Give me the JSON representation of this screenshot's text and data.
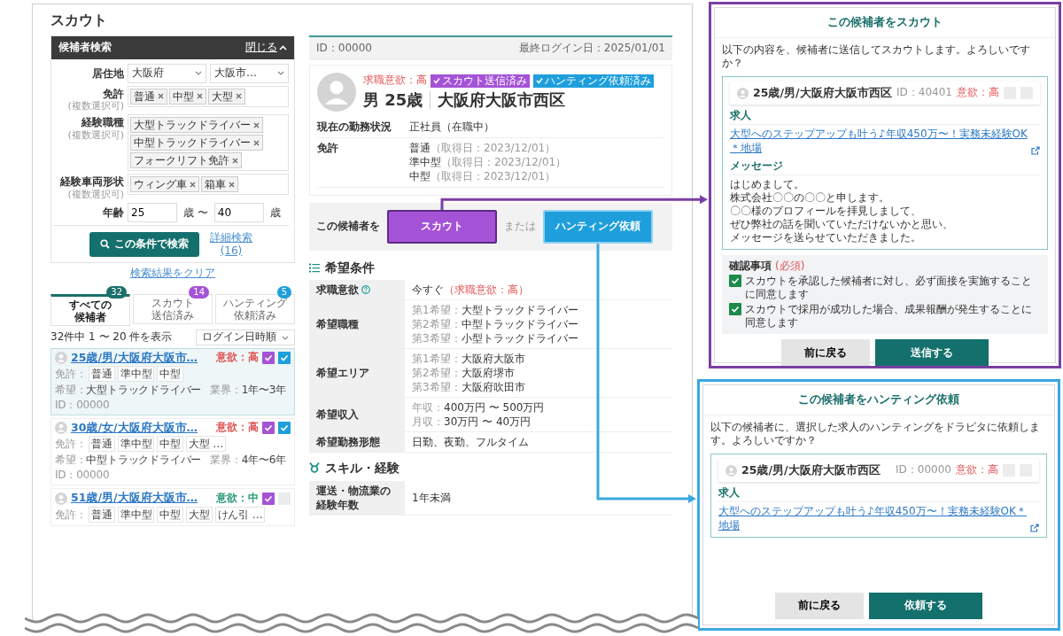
{
  "page": {
    "title": "スカウト"
  },
  "search_panel": {
    "title": "候補者検索",
    "toggle": "閉じる",
    "expanded": true,
    "fields": [
      {
        "kind": "selects",
        "label": "居住地",
        "values": [
          "大阪府",
          "大阪市…"
        ]
      },
      {
        "kind": "tags",
        "label": "免許",
        "note": "(複数選択可)",
        "tags": [
          "普通",
          "中型",
          "大型"
        ]
      },
      {
        "kind": "tags",
        "label": "経験職種",
        "note": "(複数選択可)",
        "tags": [
          "大型トラックドライバー",
          "中型トラックドライバー",
          "フォークリフト免許"
        ]
      },
      {
        "kind": "tags",
        "label": "経験車両形状",
        "note": "(複数選択可)",
        "tags": [
          "ウィング車",
          "箱車"
        ]
      },
      {
        "kind": "range",
        "label": "年齢",
        "from": "25",
        "middle": "歳 〜",
        "to": "40",
        "unit": "歳"
      }
    ],
    "search_button": "この条件で検索",
    "advanced_link": "詳細検索",
    "advanced_count": "(16)"
  },
  "clear_link": "検索結果をクリア",
  "tabs": [
    {
      "label": [
        "すべての",
        "候補者"
      ],
      "count": "32",
      "color": "#1b6f6b",
      "selected": true
    },
    {
      "label": [
        "スカウト",
        "送信済み"
      ],
      "count": "14",
      "color": "#a553d6",
      "selected": false
    },
    {
      "label": [
        "ハンティング",
        "依頼済み"
      ],
      "count": "5",
      "color": "#1e9fdc",
      "selected": false
    }
  ],
  "results": {
    "summary": "32件中 1 〜 20 件を表示",
    "sort": "ログイン日時順"
  },
  "candidates": [
    {
      "name": "25歳/男/大阪府大阪市…",
      "motivation": "意欲：高",
      "color": "#e05555",
      "scout_sent": true,
      "hunting_requested": true,
      "selected": true,
      "license_label": "免許：",
      "licenses": [
        "普通",
        "準中型",
        "中型"
      ],
      "wish_label": "希望：",
      "wish": "大型トラックドライバー",
      "industry_label": "業界：",
      "industry": "1年〜3年",
      "id": "ID：00000"
    },
    {
      "name": "30歳/女/大阪府大阪市…",
      "motivation": "意欲：高",
      "color": "#e05555",
      "scout_sent": true,
      "hunting_requested": true,
      "selected": false,
      "license_label": "免許：",
      "licenses": [
        "普通",
        "準中型",
        "中型",
        "大型 …"
      ],
      "wish_label": "希望：",
      "wish": "中型トラックドライバー",
      "industry_label": "業界：",
      "industry": "4年〜6年",
      "id": "ID：00000"
    },
    {
      "name": "51歳/男/大阪府大阪市…",
      "motivation": "意欲：中",
      "color": "#2a9a7a",
      "scout_sent": true,
      "hunting_requested": false,
      "selected": false,
      "license_label": "免許：",
      "licenses": [
        "普通",
        "準中型",
        "中型",
        "大型",
        "けん引 …"
      ]
    }
  ],
  "detail": {
    "id": "ID：00000",
    "last_login": "最終ログイン日：2025/01/01",
    "motivation": "求職意欲：高",
    "badges": [
      {
        "label": "スカウト送信済み",
        "color": "#a553d6"
      },
      {
        "label": "ハンティング依頼済み",
        "color": "#1e9fdc"
      }
    ],
    "gender_age": "男 25歳",
    "location": "大阪府大阪市西区",
    "facts": [
      {
        "label": "現在の勤務状況",
        "lines": [
          [
            {
              "text": "正社員（在職中）"
            }
          ]
        ]
      },
      {
        "label": "免許",
        "lines": [
          [
            {
              "text": "普通"
            },
            {
              "text": "（取得日：2023/12/01）",
              "kind": "muted"
            }
          ],
          [
            {
              "text": "準中型"
            },
            {
              "text": "（取得日：2023/12/01）",
              "kind": "muted"
            }
          ],
          [
            {
              "text": "中型"
            },
            {
              "text": "（取得日：2023/12/01）",
              "kind": "muted"
            }
          ]
        ]
      }
    ]
  },
  "actions": {
    "lead": "この候補者を",
    "scout": "スカウト",
    "or": "または",
    "hunting": "ハンティング依頼"
  },
  "sections": [
    {
      "kind": "list",
      "title": "希望条件",
      "rows": [
        {
          "label": "求職意欲",
          "help": true,
          "lines": [
            [
              {
                "text": "今すぐ"
              },
              {
                "text": "（求職意欲：高）",
                "kind": "alert"
              }
            ]
          ]
        },
        {
          "label": "希望職種",
          "help": false,
          "lines": [
            [
              {
                "text": "第1希望：",
                "kind": "muted"
              },
              {
                "text": "大型トラックドライバー"
              }
            ],
            [
              {
                "text": "第2希望：",
                "kind": "muted"
              },
              {
                "text": "中型トラックドライバー"
              }
            ],
            [
              {
                "text": "第3希望：",
                "kind": "muted"
              },
              {
                "text": "小型トラックドライバー"
              }
            ]
          ]
        },
        {
          "label": "希望エリア",
          "help": false,
          "lines": [
            [
              {
                "text": "第1希望：",
                "kind": "muted"
              },
              {
                "text": "大阪府大阪市"
              }
            ],
            [
              {
                "text": "第2希望：",
                "kind": "muted"
              },
              {
                "text": "大阪府堺市"
              }
            ],
            [
              {
                "text": "第3希望：",
                "kind": "muted"
              },
              {
                "text": "大阪府吹田市"
              }
            ]
          ]
        },
        {
          "label": "希望収入",
          "help": false,
          "lines": [
            [
              {
                "text": "年収：",
                "kind": "muted"
              },
              {
                "text": "400万円 〜 500万円"
              }
            ],
            [
              {
                "text": "月収：",
                "kind": "muted"
              },
              {
                "text": "30万円 〜 40万円"
              }
            ]
          ]
        },
        {
          "label": "希望勤務形態",
          "help": false,
          "lines": [
            [
              {
                "text": "日勤、夜勤、フルタイム"
              }
            ]
          ]
        }
      ]
    },
    {
      "kind": "skill",
      "title": "スキル・経験",
      "rows": [
        {
          "label": "運送・物流業の経験年数",
          "help": false,
          "lines": [
            [
              {
                "text": "1年未満"
              }
            ]
          ]
        }
      ]
    }
  ],
  "modals": [
    {
      "kind": "scout",
      "color": "#7b3fa3",
      "title": "この候補者をスカウト",
      "intro": "以下の内容を、候補者に送信してスカウトします。よろしいですか？",
      "candidate": {
        "name": "25歳/男/大阪府大阪市西区",
        "id": "ID：40401",
        "motivation": "意欲：高"
      },
      "job_heading": "求人",
      "job_link": "大型へのステップアップも叶う♪年収450万〜！実務未経験OK＊地場",
      "message_heading": "メッセージ",
      "message": [
        "はじめまして。",
        "株式会社〇〇の〇〇と申します。",
        "〇〇様のプロフィールを拝見しまして、",
        "ぜひ弊社の話を聞いていただけないかと思い、",
        "メッセージを送らせていただきました。"
      ],
      "confirm": {
        "title": "確認事項",
        "required": "(必須)",
        "items": [
          {
            "label": "スカウトを承認した候補者に対し、必ず面接を実施することに同意します",
            "checked": true
          },
          {
            "label": "スカウトで採用が成功した場合、成果報酬が発生することに同意します",
            "checked": true
          }
        ]
      },
      "back": "前に戻る",
      "submit": "送信する"
    },
    {
      "kind": "hunting",
      "color": "#3aa8e0",
      "title": "この候補者をハンティング依頼",
      "intro": "以下の候補者に、選択した求人のハンティングをドラピタに依頼します。よろしいですか？",
      "candidate": {
        "name": "25歳/男/大阪府大阪市西区",
        "id": "ID：00000",
        "motivation": "意欲：高"
      },
      "job_heading": "求人",
      "job_link": "大型へのステップアップも叶う♪年収450万〜！実務未経験OK＊地場",
      "back": "前に戻る",
      "submit": "依頼する"
    }
  ]
}
